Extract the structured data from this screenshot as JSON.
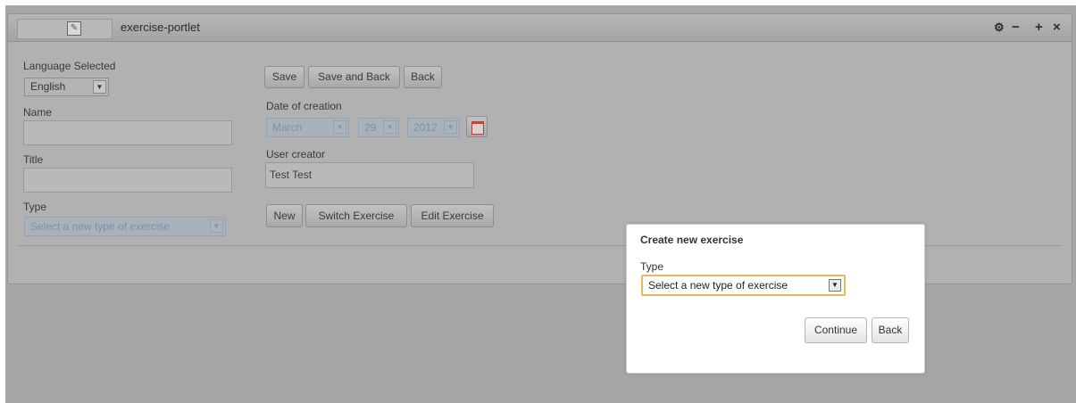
{
  "portlet": {
    "title": "exercise-portlet",
    "icon": "portlet-app-icon",
    "controls": {
      "configure_icon": "configure-icon",
      "minimize": "−",
      "maximize": "+",
      "close": "×"
    }
  },
  "form": {
    "language_label": "Language Selected",
    "language_value": "English",
    "name_label": "Name",
    "name_value": "",
    "title_label": "Title",
    "title_value": "",
    "type_label": "Type",
    "type_value": "Select a new type of exercise",
    "buttons": {
      "save": "Save",
      "save_and_back": "Save and Back",
      "back": "Back"
    },
    "date_label": "Date of creation",
    "date": {
      "month": "March",
      "day": "29",
      "year": "2012"
    },
    "user_creator_label": "User creator",
    "user_creator_value": "Test Test",
    "actions": {
      "new": "New",
      "switch_exercise": "Switch Exercise",
      "edit_exercise": "Edit Exercise"
    }
  },
  "dialog": {
    "title": "Create new exercise",
    "type_label": "Type",
    "type_value": "Select a new type of exercise",
    "continue": "Continue",
    "back": "Back"
  },
  "colors": {
    "overlay": "#a6a6a6",
    "dialog_bg": "#ffffff",
    "focus_border": "#e6b95c"
  }
}
